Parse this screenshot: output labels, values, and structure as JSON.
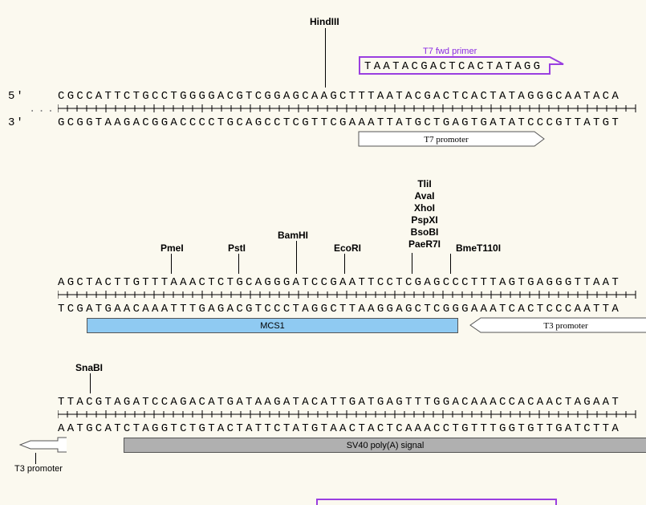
{
  "label5": "5'",
  "label3": "3'",
  "ellipsis": "...",
  "block1": {
    "top": "CGCCATTCTGCCTGGGGACGTCGGAGCAAGCTTTAATACGACTCACTATAGGGCAATACA",
    "bot": "GCGGTAAGACGGACCCCTGCAGCCTCGTTCGAAATTATGCTGAGTGATATCCCGTTATGT",
    "enzymes": {
      "HindIII": "HindIII"
    },
    "primer": {
      "label": "T7 fwd primer",
      "seq": "TAATACGACTCACTATAGG"
    },
    "feature_t7prom": "T7 promoter"
  },
  "block2": {
    "top": "AGCTACTTGTTTAAACTCTGCAGGGATCCGAATTCCTCGAGCCCTTTAGTGAGGGTTAAT",
    "bot": "TCGATGAACAAATTTGAGACGTCCCTAGGCTTAAGGAGCTCGGGAAATCACTCCCAATTA",
    "enzymes": {
      "PmeI": "PmeI",
      "PstI": "PstI",
      "BamHI": "BamHI",
      "EcoRI": "EcoRI",
      "TliI": "TliI",
      "AvaI": "AvaI",
      "XhoI": "XhoI",
      "PspXI": "PspXI",
      "BsoBI": "BsoBI",
      "PaeR7I": "PaeR7I",
      "BmeT110I": "BmeT110I"
    },
    "feature_mcs1": "MCS1",
    "feature_t3prom": "T3 promoter"
  },
  "block3": {
    "top": "TTACGTAGATCCAGACATGATAAGATACATTGATGAGTTTGGACAAACCACAACTAGAAT",
    "bot": "AATGCATCTAGGTCTGTACTATTCTATGTAACTACTCAAACCTGTTTGGTGTTGATCTTA",
    "enzymes": {
      "SnaBI": "SnaBI"
    },
    "feature_t3prom": "T3 promoter",
    "feature_sv40": "SV40 poly(A) signal"
  }
}
